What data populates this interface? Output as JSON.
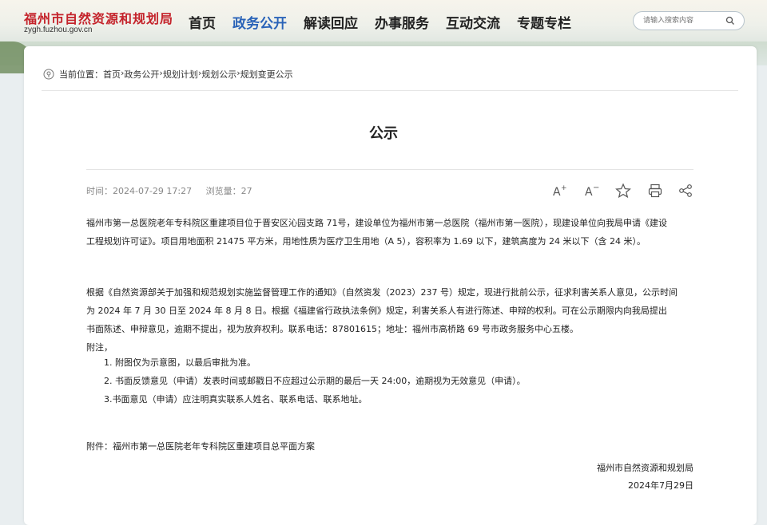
{
  "header": {
    "site_title": "福州市自然资源和规划局",
    "site_domain": "zygh.fuzhou.gov.cn",
    "nav": [
      {
        "label": "首页",
        "active": false
      },
      {
        "label": "政务公开",
        "active": true
      },
      {
        "label": "解读回应",
        "active": false
      },
      {
        "label": "办事服务",
        "active": false
      },
      {
        "label": "互动交流",
        "active": false
      },
      {
        "label": "专题专栏",
        "active": false
      }
    ],
    "search_placeholder": "请输入搜索内容",
    "accent_color": "#2a63b8",
    "brand_color": "#c4232b"
  },
  "breadcrumb": {
    "label": "当前位置：",
    "items": [
      "首页",
      "政务公开",
      "规划计划",
      "规划公示",
      "规划变更公示"
    ],
    "separator": "›"
  },
  "article": {
    "title": "公示",
    "time_label": "时间：",
    "time_value": "2024-07-29 17:27",
    "views_label": "浏览量：",
    "views_value": "27",
    "tools": [
      "font-increase-icon",
      "font-decrease-icon",
      "star-icon",
      "print-icon",
      "share-icon"
    ],
    "paragraph1_line1": "福州市第一总医院老年专科院区重建项目位于晋安区沁园支路 71号，建设单位为福州市第一总医院（福州市第一医院），现建设单位向我局申请《建设",
    "paragraph1_line2": "工程规划许可证》。项目用地面积 21475 平方米，用地性质为医疗卫生用地（A 5），容积率为 1.69 以下，建筑高度为 24 米以下（含 24 米）。",
    "paragraph2_line1": "根据《自然资源部关于加强和规范规划实施监督管理工作的通知》（自然资发（2023）237 号）规定，现进行批前公示，征求利害关系人意见，公示时间",
    "paragraph2_line2": "为 2024 年 7 月 30 日至 2024 年 8 月 8 日。根据《福建省行政执法条例》规定，利害关系人有进行陈述、申辩的权利。可在公示期限内向我局提出",
    "paragraph2_line3": "书面陈述、申辩意见，逾期不提出，视为放弃权利。联系电话：87801615；地址：福州市高桥路 69 号市政务服务中心五楼。",
    "notes_label": "附注，",
    "notes": [
      "1. 附图仅为示意图，以最后审批为准。",
      "2. 书面反馈意见（申请）发表时间或邮戳日不应超过公示期的最后一天 24:00，逾期视为无效意见（申请）。",
      "3.书面意见（申请）应注明真实联系人姓名、联系电话、联系地址。"
    ],
    "attachment": "附件：福州市第一总医院老年专科院区重建项目总平面方案",
    "signature_org": "福州市自然资源和规划局",
    "signature_date": "2024年7月29日"
  }
}
